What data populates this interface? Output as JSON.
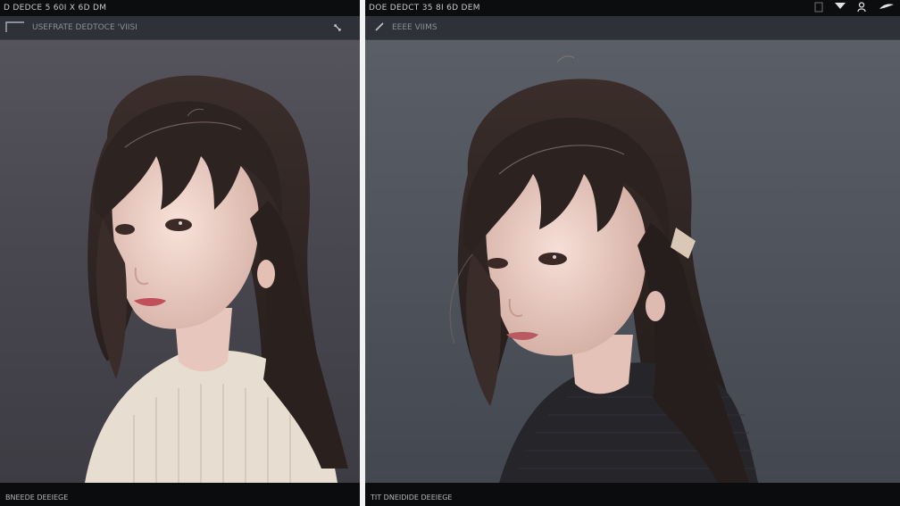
{
  "left_window": {
    "title": "D DEDCE 5 60I X 6D DM",
    "toolbar_text": "USEFRATE DEDTOCE 'VIISI",
    "status_text": "BNEEDE DEEIEGE",
    "icons": {
      "frame": "frame-icon",
      "pin": "pin-icon"
    },
    "photo": {
      "sweater_color": "#e7ddd0",
      "hair_color": "#2b211f",
      "skin_color": "#f2d7cf"
    }
  },
  "right_window": {
    "title": "DOE DEDCT 35 8I 6D DEM",
    "toolbar_text": "EEEE VIIMS",
    "status_text": "TIT DNEIDIDE DEEIEGE",
    "icons": {
      "pen": "pen-icon",
      "send": "send-icon",
      "user": "user-icon",
      "feather": "feather-icon",
      "panel": "panel-icon"
    },
    "photo": {
      "sweater_color": "#262529",
      "hair_color": "#2a211f",
      "skin_color": "#f0d3cb"
    }
  },
  "colors": {
    "titlebar": "#0c0d0f",
    "toolbar": "#2e3238",
    "separator": "#f2f2f2"
  }
}
